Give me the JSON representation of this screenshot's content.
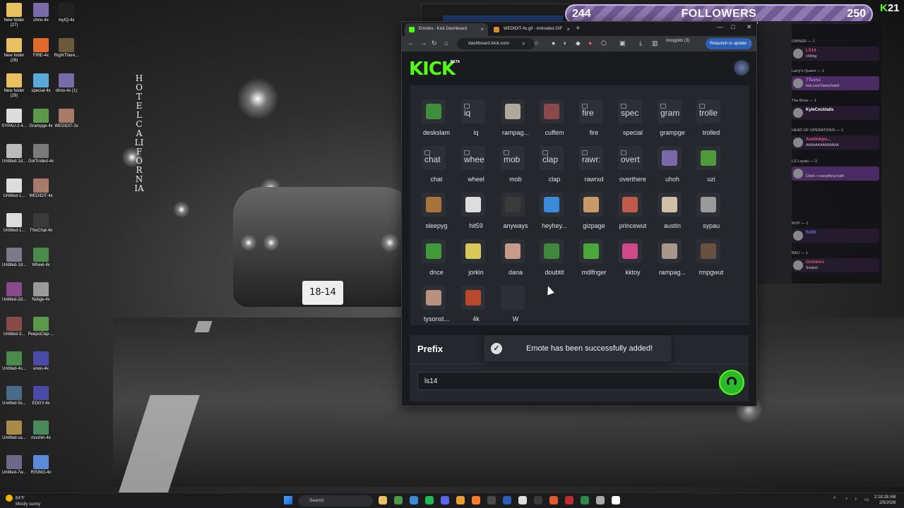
{
  "followers_widget": {
    "current": "244",
    "label": "FOLLOWERS",
    "goal": "250"
  },
  "viewer_badge": {
    "count": "21"
  },
  "browser": {
    "tabs": [
      {
        "title": "Emotes - Kick Dashboard",
        "favicon_color": "#53fc18",
        "active": true
      },
      {
        "title": "WEDIDIT-4x.gif - Animated GIF",
        "favicon_color": "#e08a2e",
        "active": false
      }
    ],
    "url": "dashboard.kick.com",
    "incognito_label": "Incognito (3)",
    "relaunch_label": "Relaunch to update"
  },
  "kick": {
    "logo": "KICK",
    "beta": "BETA",
    "emotes": [
      {
        "name": "deskslam",
        "alt": "",
        "color": "#3f8f3a"
      },
      {
        "name": "iq",
        "alt": "iq",
        "color": ""
      },
      {
        "name": "rampag...",
        "alt": "",
        "color": "#b0a89a"
      },
      {
        "name": "cuffem",
        "alt": "",
        "color": "#8a4a4a"
      },
      {
        "name": "fire",
        "alt": "fire",
        "color": ""
      },
      {
        "name": "special",
        "alt": "spec",
        "color": ""
      },
      {
        "name": "grampge",
        "alt": "gram",
        "color": ""
      },
      {
        "name": "trolled",
        "alt": "trolle",
        "color": ""
      },
      {
        "name": "chat",
        "alt": "chat",
        "color": ""
      },
      {
        "name": "wheel",
        "alt": "whee",
        "color": ""
      },
      {
        "name": "mob",
        "alt": "mob",
        "color": ""
      },
      {
        "name": "clap",
        "alt": "clap",
        "color": ""
      },
      {
        "name": "rawrxd",
        "alt": "rawr:",
        "color": ""
      },
      {
        "name": "overthere",
        "alt": "overt",
        "color": ""
      },
      {
        "name": "uhoh",
        "alt": "",
        "color": "#7a68a8"
      },
      {
        "name": "uzi",
        "alt": "",
        "color": "#4f9a3a"
      },
      {
        "name": "sleepyg",
        "alt": "",
        "color": "#a8743a"
      },
      {
        "name": "hit59",
        "alt": "",
        "color": "#dddddd"
      },
      {
        "name": "anyways",
        "alt": "",
        "color": "#3a3a3a"
      },
      {
        "name": "heyhey...",
        "alt": "",
        "color": "#3a8ad8"
      },
      {
        "name": "gizpage",
        "alt": "",
        "color": "#c89a6a"
      },
      {
        "name": "princewut",
        "alt": "",
        "color": "#c05a4a"
      },
      {
        "name": "austin",
        "alt": "",
        "color": "#d0c0a8"
      },
      {
        "name": "sypau",
        "alt": "",
        "color": "#9a9a9a"
      },
      {
        "name": "dnce",
        "alt": "",
        "color": "#3f9a3a"
      },
      {
        "name": "jorkin",
        "alt": "",
        "color": "#d8c85a"
      },
      {
        "name": "dana",
        "alt": "",
        "color": "#c89a8a"
      },
      {
        "name": "doubtit",
        "alt": "",
        "color": "#3f8a3a"
      },
      {
        "name": "mdlfnger",
        "alt": "",
        "color": "#4aa83a"
      },
      {
        "name": "kktoy",
        "alt": "",
        "color": "#d04a8a"
      },
      {
        "name": "rampag...",
        "alt": "",
        "color": "#a8988a"
      },
      {
        "name": "rmpgwut",
        "alt": "",
        "color": "#6a5040"
      },
      {
        "name": "tysonst...",
        "alt": "",
        "color": "#b89080"
      },
      {
        "name": "4k",
        "alt": "",
        "color": "#b84a2a"
      },
      {
        "name": "W",
        "alt": "",
        "color": ""
      }
    ],
    "prefix": {
      "title": "Prefix",
      "value": "ls14"
    },
    "toast": "Emote has been successfully added!"
  },
  "chat": {
    "groups": [
      {
        "label": "OWNER — 1",
        "name": "LS14",
        "msg": "chilling",
        "color": "#e05a5a"
      },
      {
        "label": "Larry's Queen — 1",
        "name": "TTasha",
        "msg": "kick.com/TashaTookIt",
        "color": "#c07adf"
      },
      {
        "label": "The Boss — 1",
        "name": "KyleCocktails",
        "msg": "",
        "color": "#ffffff"
      },
      {
        "label": "HEAD OF OPERATIONS — 1",
        "name": "Austinhjes...",
        "msg": "AAAAAAAAAAAAAA",
        "color": "#e05a8a"
      },
      {
        "label": "LS Loyals — 3",
        "name": "",
        "msg": "Christ > everything Faith",
        "color": "#7a9aff"
      },
      {
        "label": "MVP — 1",
        "name": "fbi09",
        "msg": "",
        "color": "#7a6acf"
      },
      {
        "label": "BAU — 1",
        "name": "Octobers",
        "msg": "Soaked",
        "color": "#e05a5a"
      }
    ]
  },
  "desktop": {
    "icons": [
      {
        "label": "New folder (27)",
        "color": "#e8c060"
      },
      {
        "label": "ohno-4x",
        "color": "#7a6aa8"
      },
      {
        "label": "myIQ-4x",
        "color": "#222222"
      },
      {
        "label": "New folder (28)",
        "color": "#e8c060"
      },
      {
        "label": "FIRE-4x",
        "color": "#e06a2a"
      },
      {
        "label": "RightThere...",
        "color": "#6a5a3a"
      },
      {
        "label": "New folder (29)",
        "color": "#e8c060"
      },
      {
        "label": "special-4x",
        "color": "#5aa8d8"
      },
      {
        "label": "ohno-4x (1)",
        "color": "#7a6aa8"
      },
      {
        "label": "SYPAU-2-4...",
        "color": "#dddddd"
      },
      {
        "label": "Grampge-4x",
        "color": "#5a9a4a"
      },
      {
        "label": "WEDIDIT-2x",
        "color": "#a87a6a"
      },
      {
        "label": "Untitled-1d...",
        "color": "#bbbbbb"
      },
      {
        "label": "GotTrolled-4x",
        "color": "#7a7a7a"
      },
      {
        "label": "Untitled-1...",
        "color": "#dddddd"
      },
      {
        "label": "WEDIDIT-4x",
        "color": "#a87a6a"
      },
      {
        "label": "Untitled-1...",
        "color": "#dddddd"
      },
      {
        "label": "ThisChat-4x",
        "color": "#3a3a3a"
      },
      {
        "label": "Untitled-1d...",
        "color": "#7a7a8a"
      },
      {
        "label": "Wheel-4x",
        "color": "#4a8a4a"
      },
      {
        "label": "Untitled-2d...",
        "color": "#8a4a8a"
      },
      {
        "label": "Nolige-4x",
        "color": "#9a9a9a"
      },
      {
        "label": "Untitled-3...",
        "color": "#8a4a4a"
      },
      {
        "label": "PeepoClap-...",
        "color": "#5a9a4a"
      },
      {
        "label": "Untitled-4s...",
        "color": "#4a8a4a"
      },
      {
        "label": "enoo-4x",
        "color": "#4a4aa8"
      },
      {
        "label": "Untitled-5s...",
        "color": "#4a6a8a"
      },
      {
        "label": "EDGY-4x",
        "color": "#4a4aa8"
      },
      {
        "label": "Untitled-sa...",
        "color": "#a88a4a"
      },
      {
        "label": "moshin-4x",
        "color": "#4a8a5a"
      },
      {
        "label": "Untitled-7w...",
        "color": "#6a6a8a"
      },
      {
        "label": "RISING-4x",
        "color": "#5a8ad8"
      }
    ]
  },
  "taskbar": {
    "weather_temp": "64°F",
    "weather_desc": "Mostly sunny",
    "search": "Search",
    "time": "2:18:28 AM",
    "date": "2/5/2026",
    "apps": [
      "#e8c060",
      "#4a9a4a",
      "#3a8ad8",
      "#1db954",
      "#5865f2",
      "#e8a030",
      "#ff7a2a",
      "#4a4a4a",
      "#2a5fb5",
      "#dddddd",
      "#3a3a3a",
      "#e05a2a",
      "#c02a2a",
      "#2a8a4a",
      "#aaaaaa",
      "#ffffff"
    ]
  }
}
